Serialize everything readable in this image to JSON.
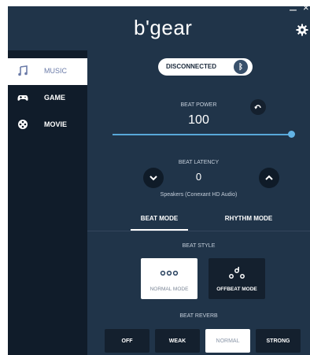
{
  "app": {
    "logo": "b'gear"
  },
  "window": {
    "minimize": "–",
    "close": "×"
  },
  "sidebar": {
    "items": [
      {
        "label": "MUSIC",
        "icon": "music-note-icon",
        "active": true
      },
      {
        "label": "GAME",
        "icon": "gamepad-icon",
        "active": false
      },
      {
        "label": "MOVIE",
        "icon": "film-reel-icon",
        "active": false
      }
    ]
  },
  "connection": {
    "status": "DISCONNECTED",
    "icon": "bluetooth-icon"
  },
  "beat_power": {
    "label": "BEAT POWER",
    "value": "100",
    "level": 1.0
  },
  "beat_latency": {
    "label": "BEAT LATENCY",
    "value": "0",
    "device": "Speakers (Conexant HD Audio)"
  },
  "tabs": [
    {
      "label": "BEAT MODE",
      "active": true
    },
    {
      "label": "RHYTHM MODE",
      "active": false
    }
  ],
  "beat_style": {
    "label": "BEAT STYLE",
    "options": [
      {
        "label": "NORMAL MODE",
        "icon": "three-dots-icon",
        "active": true
      },
      {
        "label": "OFFBEAT MODE",
        "icon": "offbeat-dots-icon",
        "active": false
      }
    ]
  },
  "beat_reverb": {
    "label": "BEAT REVERB",
    "options": [
      {
        "label": "OFF",
        "active": false
      },
      {
        "label": "WEAK",
        "active": false
      },
      {
        "label": "NORMAL",
        "active": true
      },
      {
        "label": "STRONG",
        "active": false
      }
    ]
  },
  "colors": {
    "panel": "#203449",
    "sidebar": "#101c2a",
    "slider": "#58a8d8",
    "button_dark": "#14202e"
  }
}
